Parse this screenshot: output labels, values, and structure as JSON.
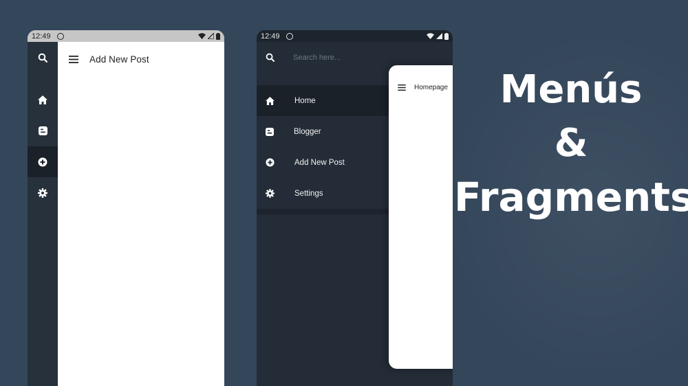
{
  "colors": {
    "background": "#34465a",
    "drawer": "#232c37",
    "rail": "#27313c",
    "active_item": "#1a2129",
    "content": "#ffffff"
  },
  "phone_left": {
    "status_time": "12:49",
    "rail_items": [
      {
        "icon": "search-icon"
      },
      {
        "icon": "home-icon"
      },
      {
        "icon": "blogger-icon"
      },
      {
        "icon": "add-circle-icon",
        "active": true
      },
      {
        "icon": "settings-icon"
      }
    ],
    "toolbar_icon": "menu-icon",
    "toolbar_title": "Add New Post"
  },
  "phone_right": {
    "status_time": "12:49",
    "search_placeholder": "Search here...",
    "menu_items": [
      {
        "icon": "home-icon",
        "label": "Home",
        "active": true
      },
      {
        "icon": "blogger-icon",
        "label": "Blogger"
      },
      {
        "icon": "add-circle-icon",
        "label": "Add New Post"
      },
      {
        "icon": "settings-icon",
        "label": "Settings"
      }
    ],
    "content_title": "Homepage",
    "content_icon": "menu-icon"
  },
  "heading": {
    "line1": "Menús",
    "line2": "&",
    "line3": "Fragments"
  }
}
